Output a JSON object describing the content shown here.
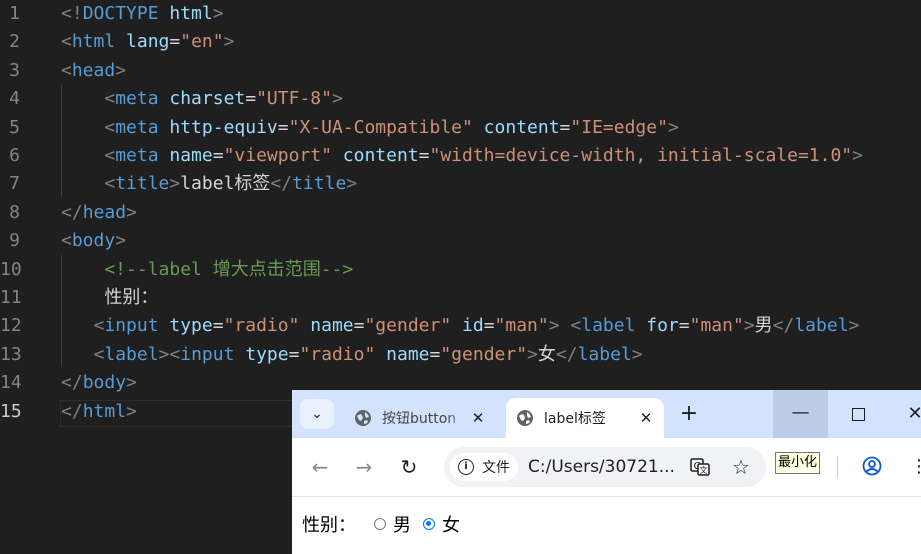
{
  "editor": {
    "line_numbers": [
      "1",
      "2",
      "3",
      "4",
      "5",
      "6",
      "7",
      "8",
      "9",
      "10",
      "11",
      "12",
      "13",
      "14",
      "15"
    ],
    "active_line": "15",
    "lines": [
      [
        {
          "t": "<!",
          "c": "br"
        },
        {
          "t": "DOCTYPE",
          "c": "tag"
        },
        {
          "t": " html",
          "c": "attr"
        },
        {
          "t": ">",
          "c": "br"
        }
      ],
      [
        {
          "t": "<",
          "c": "br"
        },
        {
          "t": "html",
          "c": "tag"
        },
        {
          "t": " lang",
          "c": "attr"
        },
        {
          "t": "=",
          "c": "txt"
        },
        {
          "t": "\"en\"",
          "c": "str"
        },
        {
          "t": ">",
          "c": "br"
        }
      ],
      [
        {
          "t": "<",
          "c": "br"
        },
        {
          "t": "head",
          "c": "tag"
        },
        {
          "t": ">",
          "c": "br"
        }
      ],
      [
        {
          "t": "    <",
          "c": "br"
        },
        {
          "t": "meta",
          "c": "tag"
        },
        {
          "t": " charset",
          "c": "attr"
        },
        {
          "t": "=",
          "c": "txt"
        },
        {
          "t": "\"UTF-8\"",
          "c": "str"
        },
        {
          "t": ">",
          "c": "br"
        }
      ],
      [
        {
          "t": "    <",
          "c": "br"
        },
        {
          "t": "meta",
          "c": "tag"
        },
        {
          "t": " http-equiv",
          "c": "attr"
        },
        {
          "t": "=",
          "c": "txt"
        },
        {
          "t": "\"X-UA-Compatible\"",
          "c": "str"
        },
        {
          "t": " content",
          "c": "attr"
        },
        {
          "t": "=",
          "c": "txt"
        },
        {
          "t": "\"IE=edge\"",
          "c": "str"
        },
        {
          "t": ">",
          "c": "br"
        }
      ],
      [
        {
          "t": "    <",
          "c": "br"
        },
        {
          "t": "meta",
          "c": "tag"
        },
        {
          "t": " name",
          "c": "attr"
        },
        {
          "t": "=",
          "c": "txt"
        },
        {
          "t": "\"viewport\"",
          "c": "str"
        },
        {
          "t": " content",
          "c": "attr"
        },
        {
          "t": "=",
          "c": "txt"
        },
        {
          "t": "\"width=device-width, initial-scale=1.0\"",
          "c": "str"
        },
        {
          "t": ">",
          "c": "br"
        }
      ],
      [
        {
          "t": "    <",
          "c": "br"
        },
        {
          "t": "title",
          "c": "tag"
        },
        {
          "t": ">",
          "c": "br"
        },
        {
          "t": "label标签",
          "c": "txt"
        },
        {
          "t": "</",
          "c": "br"
        },
        {
          "t": "title",
          "c": "tag"
        },
        {
          "t": ">",
          "c": "br"
        }
      ],
      [
        {
          "t": "</",
          "c": "br"
        },
        {
          "t": "head",
          "c": "tag"
        },
        {
          "t": ">",
          "c": "br"
        }
      ],
      [
        {
          "t": "<",
          "c": "br"
        },
        {
          "t": "body",
          "c": "tag"
        },
        {
          "t": ">",
          "c": "br"
        }
      ],
      [
        {
          "t": "    <!--label 增大点击范围-->",
          "c": "cmt"
        }
      ],
      [
        {
          "t": "    性别：",
          "c": "txt"
        }
      ],
      [
        {
          "t": "   <",
          "c": "br"
        },
        {
          "t": "input",
          "c": "tag"
        },
        {
          "t": " type",
          "c": "attr"
        },
        {
          "t": "=",
          "c": "txt"
        },
        {
          "t": "\"radio\"",
          "c": "str"
        },
        {
          "t": " name",
          "c": "attr"
        },
        {
          "t": "=",
          "c": "txt"
        },
        {
          "t": "\"gender\"",
          "c": "str"
        },
        {
          "t": " id",
          "c": "attr"
        },
        {
          "t": "=",
          "c": "txt"
        },
        {
          "t": "\"man\"",
          "c": "str"
        },
        {
          "t": "> <",
          "c": "br"
        },
        {
          "t": "label",
          "c": "tag"
        },
        {
          "t": " for",
          "c": "attr"
        },
        {
          "t": "=",
          "c": "txt"
        },
        {
          "t": "\"man\"",
          "c": "str"
        },
        {
          "t": ">",
          "c": "br"
        },
        {
          "t": "男",
          "c": "txt"
        },
        {
          "t": "</",
          "c": "br"
        },
        {
          "t": "label",
          "c": "tag"
        },
        {
          "t": ">",
          "c": "br"
        }
      ],
      [
        {
          "t": "   <",
          "c": "br"
        },
        {
          "t": "label",
          "c": "tag"
        },
        {
          "t": "><",
          "c": "br"
        },
        {
          "t": "input",
          "c": "tag"
        },
        {
          "t": " type",
          "c": "attr"
        },
        {
          "t": "=",
          "c": "txt"
        },
        {
          "t": "\"radio\"",
          "c": "str"
        },
        {
          "t": " name",
          "c": "attr"
        },
        {
          "t": "=",
          "c": "txt"
        },
        {
          "t": "\"gender\"",
          "c": "str"
        },
        {
          "t": ">",
          "c": "br"
        },
        {
          "t": "女",
          "c": "txt"
        },
        {
          "t": "</",
          "c": "br"
        },
        {
          "t": "label",
          "c": "tag"
        },
        {
          "t": ">",
          "c": "br"
        }
      ],
      [
        {
          "t": "</",
          "c": "br"
        },
        {
          "t": "body",
          "c": "tag"
        },
        {
          "t": ">",
          "c": "br"
        }
      ],
      [
        {
          "t": "</",
          "c": "br"
        },
        {
          "t": "html",
          "c": "tag"
        },
        {
          "t": ">",
          "c": "br"
        }
      ]
    ]
  },
  "browser": {
    "tabs": [
      {
        "title": "按钮button",
        "close": "✕"
      },
      {
        "title": "label标签",
        "close": "✕"
      }
    ],
    "new_tab": "+",
    "window": {
      "minimize": "—",
      "close": "✕"
    },
    "nav": {
      "back": "←",
      "forward": "→",
      "reload": "↻"
    },
    "site_chip_label": "文件",
    "url": "C:/Users/30721...",
    "tooltip": "最小化",
    "page": {
      "label": "性别：",
      "options": [
        {
          "text": "男",
          "checked": false
        },
        {
          "text": "女",
          "checked": true
        }
      ]
    },
    "colors": {
      "tabstrip": "#d3e3fd",
      "radio_checked": "#0075ff"
    }
  }
}
